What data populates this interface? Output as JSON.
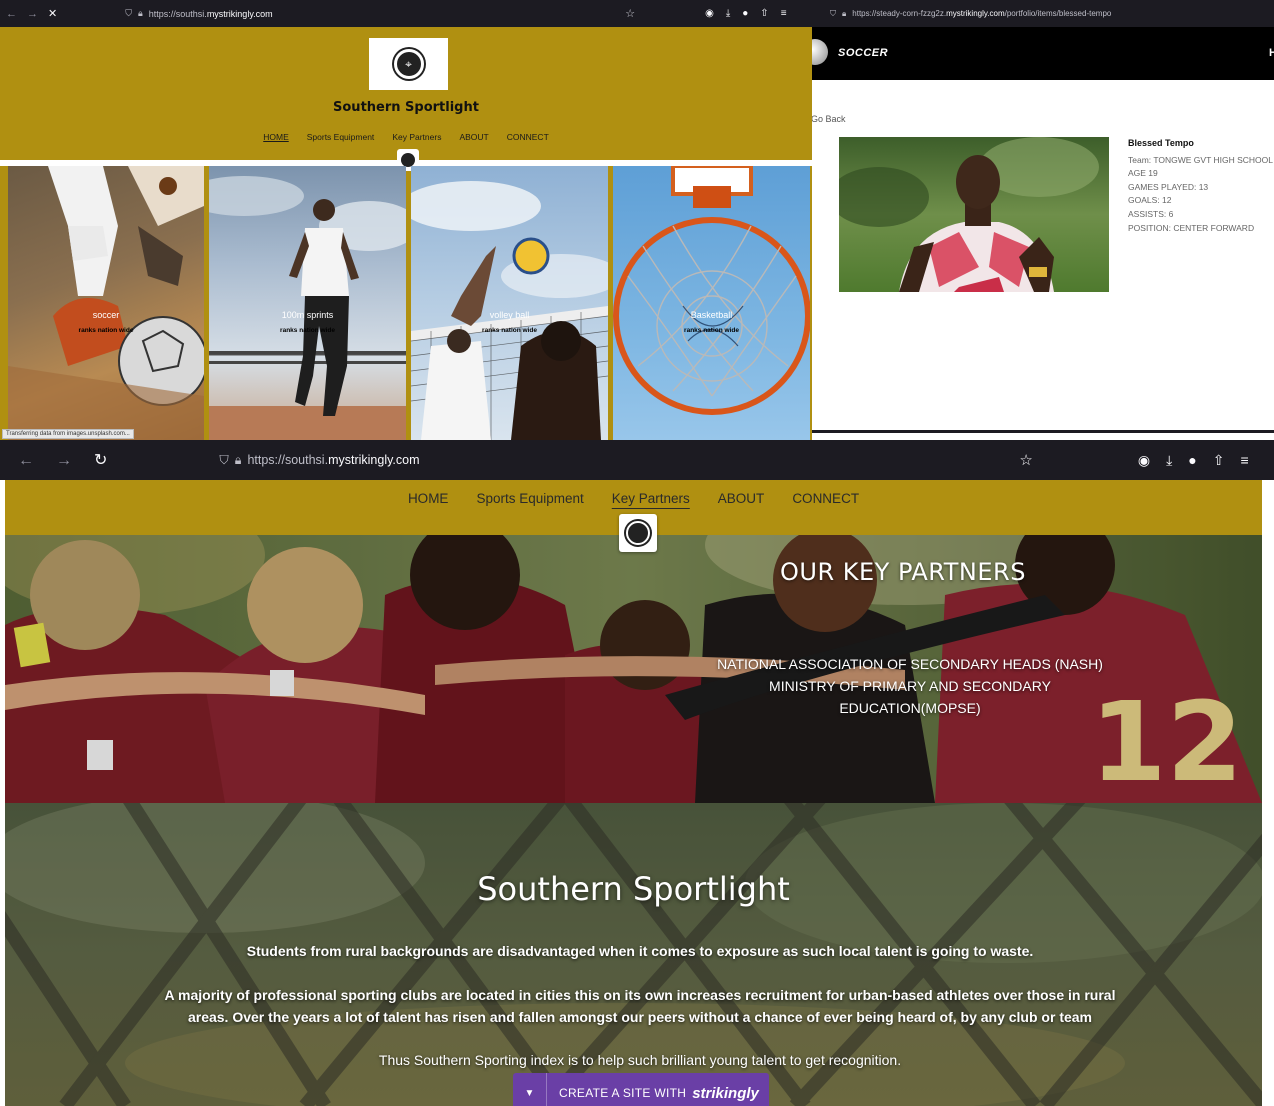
{
  "window1": {
    "url_prefix": "https://southsi.",
    "url_domain": "mystrikingly.com",
    "site_title": "Southern Sportlight",
    "nav": [
      "HOME",
      "Sports Equipment",
      "Key Partners",
      "ABOUT",
      "CONNECT"
    ],
    "active_nav": "HOME",
    "tiles": [
      {
        "caption": "soccer",
        "sub": "ranks nation wide"
      },
      {
        "caption": "100m sprints",
        "sub": "ranks nation wide"
      },
      {
        "caption": "volley ball",
        "sub": "ranks nation wide"
      },
      {
        "caption": "Basketball",
        "sub": "ranks nation wide"
      }
    ],
    "status": "Transferring data from images.unsplash.com..."
  },
  "window2": {
    "url_prefix": "https://steady-corn-fzzg2z.",
    "url_domain": "mystrikingly.com",
    "url_suffix": "/portfolio/items/blessed-tempo",
    "brand": "SOCCER",
    "header_letter": "H",
    "go_back": "Go Back",
    "player": {
      "name": "Blessed Tempo",
      "team": "Team: TONGWE GVT HIGH SCHOOL",
      "age": "AGE 19",
      "games": "GAMES PLAYED: 13",
      "goals": "GOALS: 12",
      "assists": "ASSISTS: 6",
      "position": "POSITION: CENTER FORWARD"
    }
  },
  "window3": {
    "url_prefix": "https://southsi.",
    "url_domain": "mystrikingly.com",
    "nav": [
      "HOME",
      "Sports Equipment",
      "Key Partners",
      "ABOUT",
      "CONNECT"
    ],
    "active_nav": "Key Partners",
    "partners_title": "OUR KEY PARTNERS",
    "partners": [
      "NATIONAL ASSOCIATION OF SECONDARY HEADS (NASH)",
      "MINISTRY OF PRIMARY AND SECONDARY",
      "EDUCATION(MOPSE)"
    ],
    "about_title": "Southern Sportlight",
    "about_p1": "Students from rural backgrounds are disadvantaged when it comes to exposure as such local talent is going to waste.",
    "about_p2": "A majority of professional sporting clubs are located in cities this on its own increases recruitment for urban-based athletes over those in rural areas. Over the years a lot of talent has risen and fallen amongst our peers without a chance of ever being heard of, by any club or team",
    "about_p3": "Thus Southern Sporting index is to help such brilliant young talent to get recognition.",
    "cta_text": "CREATE A SITE WITH",
    "cta_brand": "strikingly"
  },
  "colors": {
    "gold": "#b09011",
    "chrome": "#1c1b22",
    "cta": "#6a3fa6"
  }
}
